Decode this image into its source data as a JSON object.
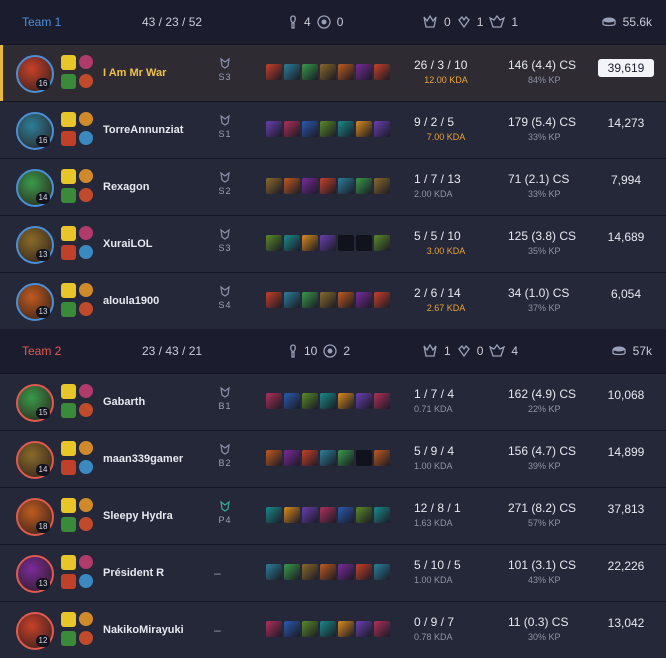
{
  "teams": [
    {
      "name": "Team 1",
      "kda": "43 / 23 / 52",
      "wards_placed": "4",
      "wards_destroyed": "0",
      "objectives": [
        "0",
        "1",
        "1"
      ],
      "gold": "55.6k",
      "color": "#4a90d9",
      "players": [
        {
          "name": "I Am Mr War",
          "level": "16",
          "rank": "S3",
          "kda": "26 / 3 / 10",
          "ratio": "12.00 KDA",
          "cs": "146 (4.4) CS",
          "kp": "84% KP",
          "gold": "39,619",
          "gold_pct": 1.0,
          "highlight": true
        },
        {
          "name": "TorreAnnunziat",
          "level": "16",
          "rank": "S1",
          "kda": "9 / 2 / 5",
          "ratio": "7.00 KDA",
          "cs": "179 (5.4) CS",
          "kp": "33% KP",
          "gold": "14,273",
          "gold_pct": 0.36
        },
        {
          "name": "Rexagon",
          "level": "14",
          "rank": "S2",
          "kda": "1 / 7 / 13",
          "ratio": "2.00 KDA",
          "cs": "71 (2.1) CS",
          "kp": "33% KP",
          "gold": "7,994",
          "gold_pct": 0.2
        },
        {
          "name": "XuraiLOL",
          "level": "13",
          "rank": "S3",
          "kda": "5 / 5 / 10",
          "ratio": "3.00 KDA",
          "cs": "125 (3.8) CS",
          "kp": "35% KP",
          "gold": "14,689",
          "gold_pct": 0.37
        },
        {
          "name": "aloula1900",
          "level": "13",
          "rank": "S4",
          "kda": "2 / 6 / 14",
          "ratio": "2.67 KDA",
          "cs": "34 (1.0) CS",
          "kp": "37% KP",
          "gold": "6,054",
          "gold_pct": 0.15
        }
      ]
    },
    {
      "name": "Team 2",
      "kda": "23 / 43 / 21",
      "wards_placed": "10",
      "wards_destroyed": "2",
      "objectives": [
        "1",
        "0",
        "4"
      ],
      "gold": "57k",
      "color": "#e05a4f",
      "players": [
        {
          "name": "Gabarth",
          "level": "15",
          "rank": "B1",
          "kda": "1 / 7 / 4",
          "ratio": "0.71 KDA",
          "cs": "162 (4.9) CS",
          "kp": "22% KP",
          "gold": "10,068",
          "gold_pct": 0.25
        },
        {
          "name": "maan339gamer",
          "level": "14",
          "rank": "B2",
          "kda": "5 / 9 / 4",
          "ratio": "1.00 KDA",
          "cs": "156 (4.7) CS",
          "kp": "39% KP",
          "gold": "14,899",
          "gold_pct": 0.38
        },
        {
          "name": "Sleepy Hydra",
          "level": "18",
          "rank": "P4",
          "kda": "12 / 8 / 1",
          "ratio": "1.63 KDA",
          "cs": "271 (8.2) CS",
          "kp": "57% KP",
          "gold": "37,813",
          "gold_pct": 0.95
        },
        {
          "name": "Président R",
          "level": "13",
          "rank": "–",
          "kda": "5 / 10 / 5",
          "ratio": "1.00 KDA",
          "cs": "101 (3.1) CS",
          "kp": "43% KP",
          "gold": "22,226",
          "gold_pct": 0.56
        },
        {
          "name": "NakikoMirayuki",
          "level": "12",
          "rank": "–",
          "kda": "0 / 9 / 7",
          "ratio": "0.78 KDA",
          "cs": "11 (0.3) CS",
          "kp": "30% KP",
          "gold": "13,042",
          "gold_pct": 0.33
        }
      ]
    }
  ],
  "colors": {
    "team1": "#4a90d9",
    "team2": "#e05a4f",
    "highlight": "#e8b93a",
    "gold_ratio": "#e8a23a"
  }
}
